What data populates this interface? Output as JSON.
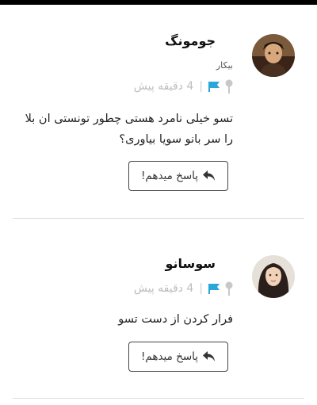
{
  "comments": [
    {
      "author": "جومونگ",
      "role": "بیکار",
      "time": "4 دقیقه پیش",
      "text": "تسو خیلی نامرد هستی چطور تونستی ان بلا را سر بانو سویا بیاوری؟",
      "reply_label": "پاسخ میدهم!",
      "avatar_icon": "avatar-photo"
    },
    {
      "author": "سوسانو",
      "role": "",
      "time": "4 دقیقه پیش",
      "text": "فرار کردن از دست تسو",
      "reply_label": "پاسخ میدهم!",
      "avatar_icon": "avatar-photo"
    }
  ],
  "meta": {
    "separator": "|"
  },
  "colors": {
    "flag": "#2aa6d8",
    "pin": "#c8c8c8",
    "divider": "#dcdcdc"
  }
}
